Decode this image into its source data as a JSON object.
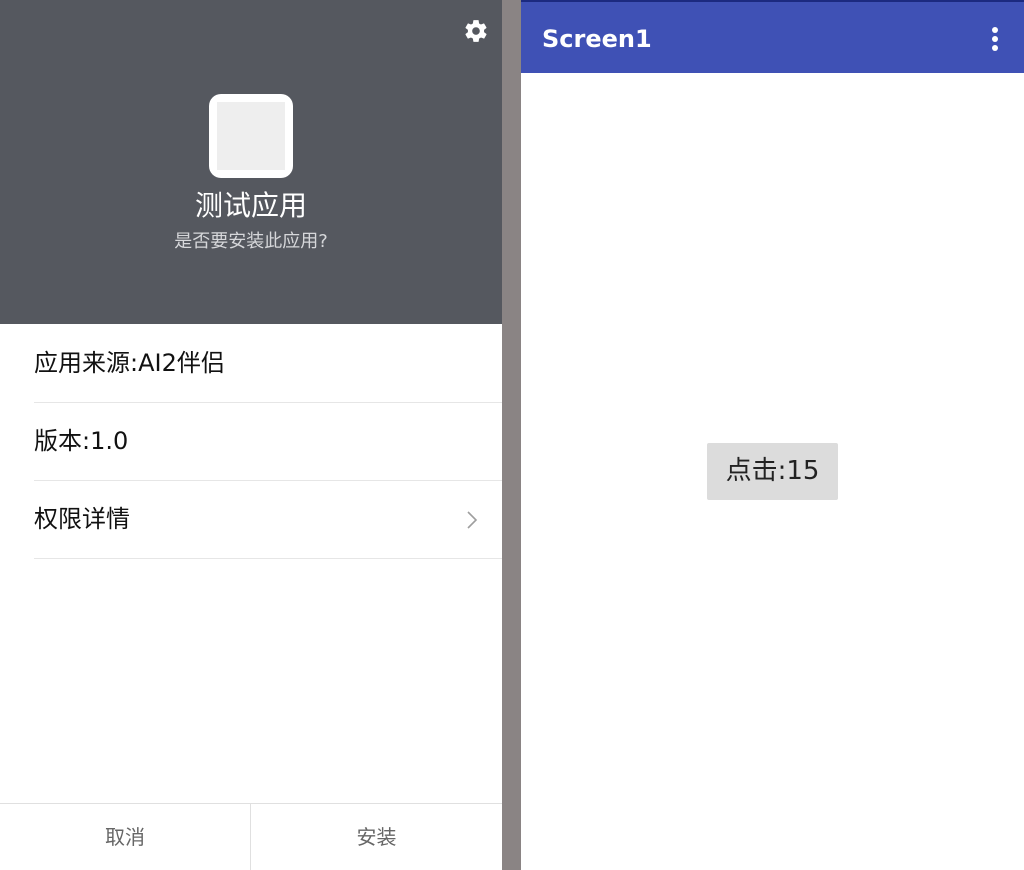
{
  "installer": {
    "app_name": "测试应用",
    "prompt": "是否要安装此应用?",
    "rows": [
      {
        "label": "应用来源:AI2伴侣"
      },
      {
        "label": "版本:1.0"
      },
      {
        "label": "权限详情"
      }
    ],
    "buttons": {
      "cancel": "取消",
      "install": "安装"
    },
    "icons": {
      "settings": "gear-icon",
      "details": "chevron-right-icon"
    }
  },
  "app_screen": {
    "title": "Screen1",
    "button_label": "点击:15",
    "colors": {
      "appbar": "#3f51b5",
      "button": "#dcdcdc"
    },
    "icons": {
      "menu": "more-vert-icon"
    }
  }
}
